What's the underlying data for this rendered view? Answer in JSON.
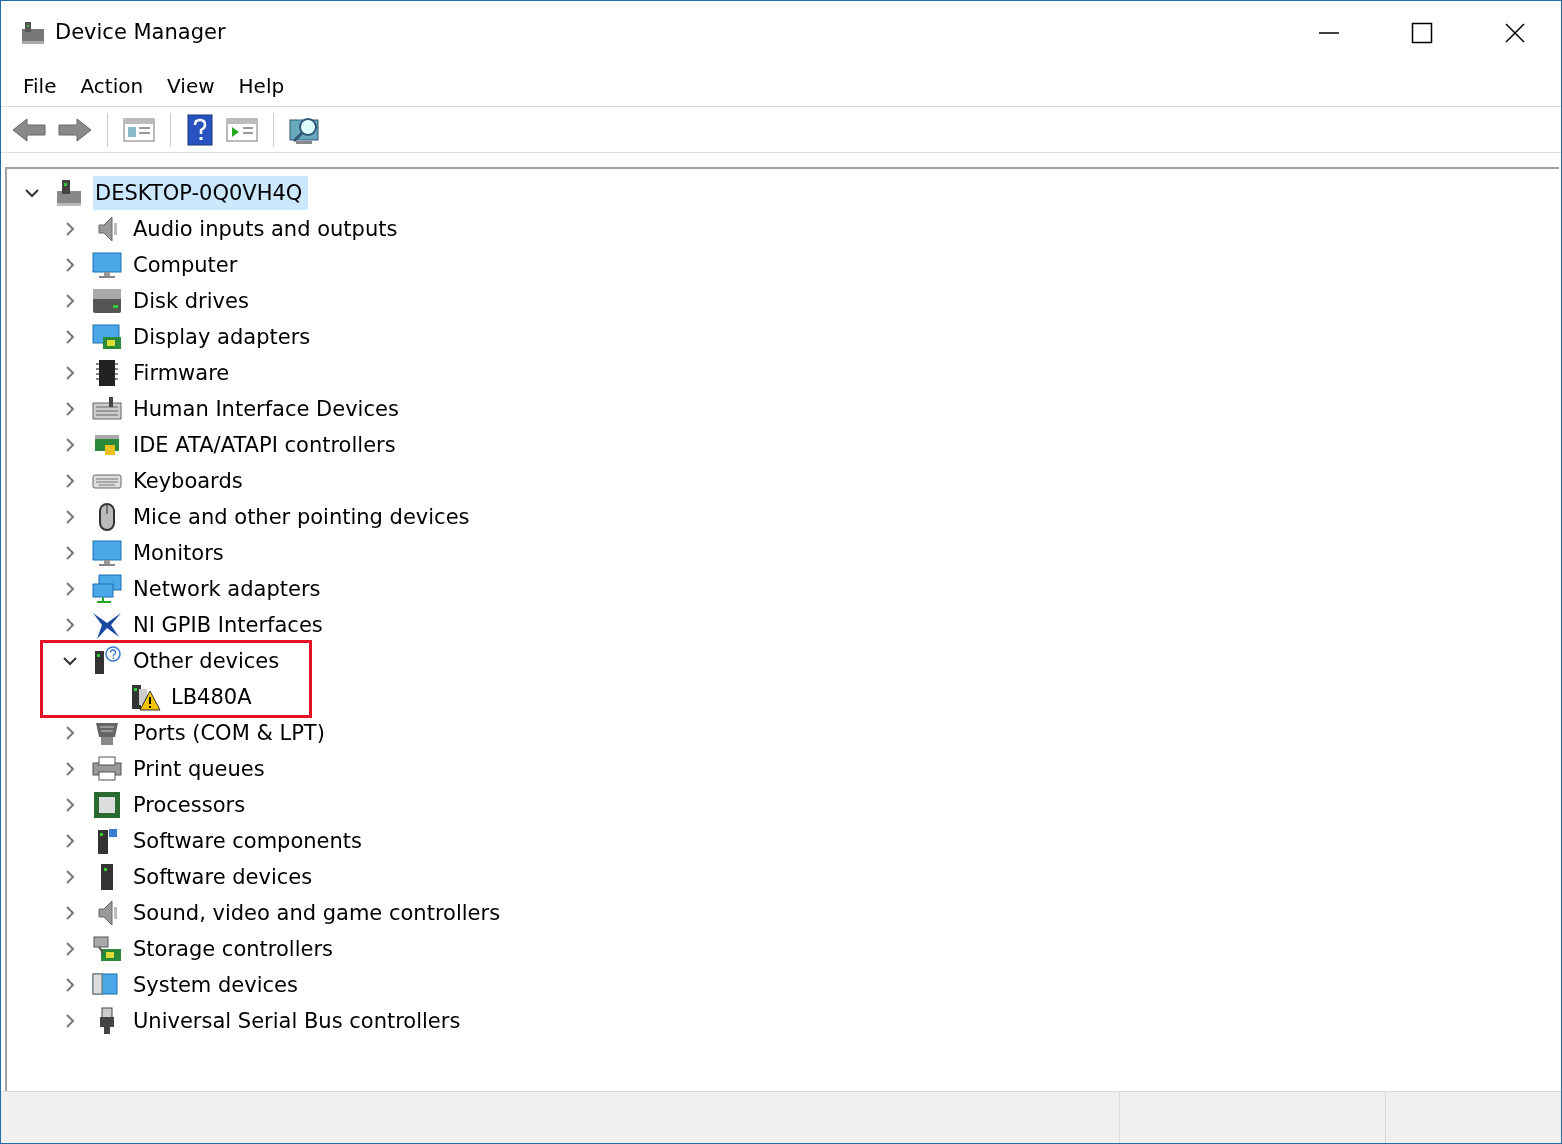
{
  "window": {
    "title": "Device Manager"
  },
  "menu": [
    "File",
    "Action",
    "View",
    "Help"
  ],
  "tree": {
    "label": "DESKTOP-0Q0VH4Q",
    "kind": "computer-tower",
    "expanded": true,
    "selected": true,
    "children": [
      {
        "label": "Audio inputs and outputs",
        "kind": "speaker",
        "expanded": false
      },
      {
        "label": "Computer",
        "kind": "monitor",
        "expanded": false
      },
      {
        "label": "Disk drives",
        "kind": "drive",
        "expanded": false
      },
      {
        "label": "Display adapters",
        "kind": "display-card",
        "expanded": false
      },
      {
        "label": "Firmware",
        "kind": "chip",
        "expanded": false
      },
      {
        "label": "Human Interface Devices",
        "kind": "hid",
        "expanded": false
      },
      {
        "label": "IDE ATA/ATAPI controllers",
        "kind": "card",
        "expanded": false
      },
      {
        "label": "Keyboards",
        "kind": "keyboard",
        "expanded": false
      },
      {
        "label": "Mice and other pointing devices",
        "kind": "mouse",
        "expanded": false
      },
      {
        "label": "Monitors",
        "kind": "monitor",
        "expanded": false
      },
      {
        "label": "Network adapters",
        "kind": "network",
        "expanded": false
      },
      {
        "label": "NI GPIB Interfaces",
        "kind": "ni",
        "expanded": false
      },
      {
        "label": "Other devices",
        "kind": "unknown",
        "expanded": true,
        "highlighted": true,
        "children": [
          {
            "label": "LB480A",
            "kind": "warning-device"
          }
        ]
      },
      {
        "label": "Ports (COM & LPT)",
        "kind": "port",
        "expanded": false
      },
      {
        "label": "Print queues",
        "kind": "printer",
        "expanded": false
      },
      {
        "label": "Processors",
        "kind": "processor",
        "expanded": false
      },
      {
        "label": "Software components",
        "kind": "software-component",
        "expanded": false
      },
      {
        "label": "Software devices",
        "kind": "tower",
        "expanded": false
      },
      {
        "label": "Sound, video and game controllers",
        "kind": "speaker",
        "expanded": false
      },
      {
        "label": "Storage controllers",
        "kind": "storage",
        "expanded": false
      },
      {
        "label": "System devices",
        "kind": "system",
        "expanded": false
      },
      {
        "label": "Universal Serial Bus controllers",
        "kind": "usb",
        "expanded": false
      }
    ]
  }
}
